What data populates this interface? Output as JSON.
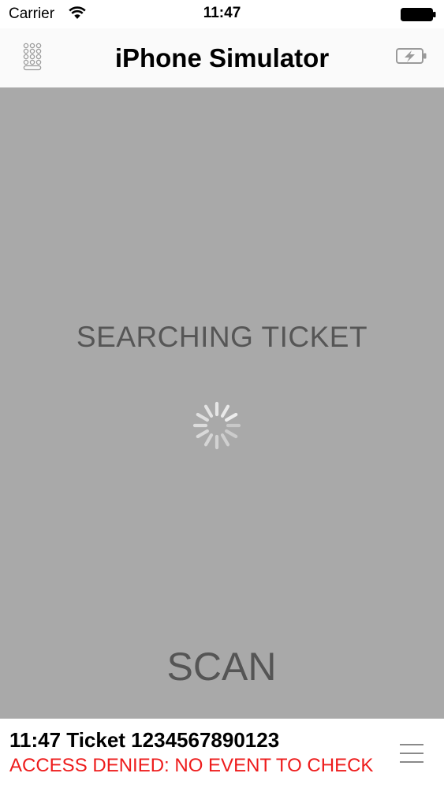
{
  "status_bar": {
    "carrier": "Carrier",
    "time": "11:47",
    "wifi_icon": "wifi-icon",
    "battery_icon": "battery-icon"
  },
  "nav_bar": {
    "title": "iPhone Simulator",
    "left_icon": "keypad-icon",
    "right_icon": "battery-charge-icon"
  },
  "scan_area": {
    "status_text": "SEARCHING TICKET",
    "spinner_icon": "activity-spinner-icon",
    "scan_label": "SCAN",
    "background_color": "#a9a9a9"
  },
  "result": {
    "title": "11:47 Ticket 1234567890123",
    "status": "ACCESS DENIED: NO EVENT TO CHECK",
    "status_color": "#ee1c1c",
    "menu_icon": "hamburger-menu-icon"
  }
}
